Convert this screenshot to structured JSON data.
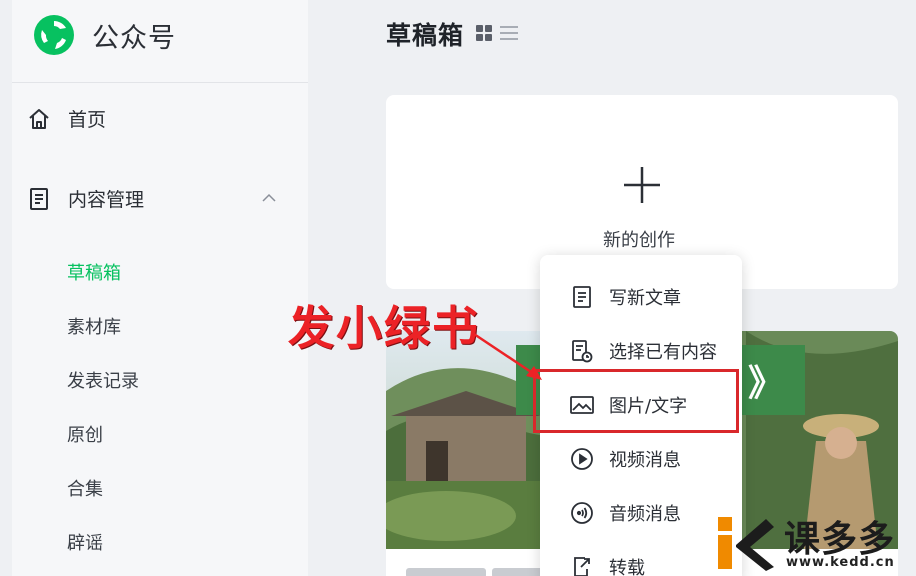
{
  "brand": {
    "name": "公众号",
    "logo_icon": "wechat-official-account-logo"
  },
  "sidebar": {
    "home": {
      "label": "首页",
      "icon": "home-icon"
    },
    "content_mgmt": {
      "label": "内容管理",
      "icon": "document-icon",
      "expanded": true
    },
    "sub_items": [
      {
        "label": "草稿箱",
        "active": true
      },
      {
        "label": "素材库",
        "active": false
      },
      {
        "label": "发表记录",
        "active": false
      },
      {
        "label": "原创",
        "active": false
      },
      {
        "label": "合集",
        "active": false
      },
      {
        "label": "辟谣",
        "active": false
      }
    ]
  },
  "main": {
    "title": "草稿箱",
    "new_creation_label": "新的创作"
  },
  "dropdown": {
    "items": [
      {
        "label": "写新文章",
        "icon": "article-icon"
      },
      {
        "label": "选择已有内容",
        "icon": "existing-content-icon"
      },
      {
        "label": "图片/文字",
        "icon": "image-icon",
        "highlighted": true
      },
      {
        "label": "视频消息",
        "icon": "play-icon"
      },
      {
        "label": "音频消息",
        "icon": "audio-icon"
      },
      {
        "label": "转载",
        "icon": "repost-icon"
      }
    ]
  },
  "annotation": {
    "text": "发小绿书"
  },
  "watermark": {
    "text": "课多多",
    "url": "www.kedd.cn"
  },
  "colors": {
    "accent": "#07c160",
    "annotation": "#ec2226"
  }
}
